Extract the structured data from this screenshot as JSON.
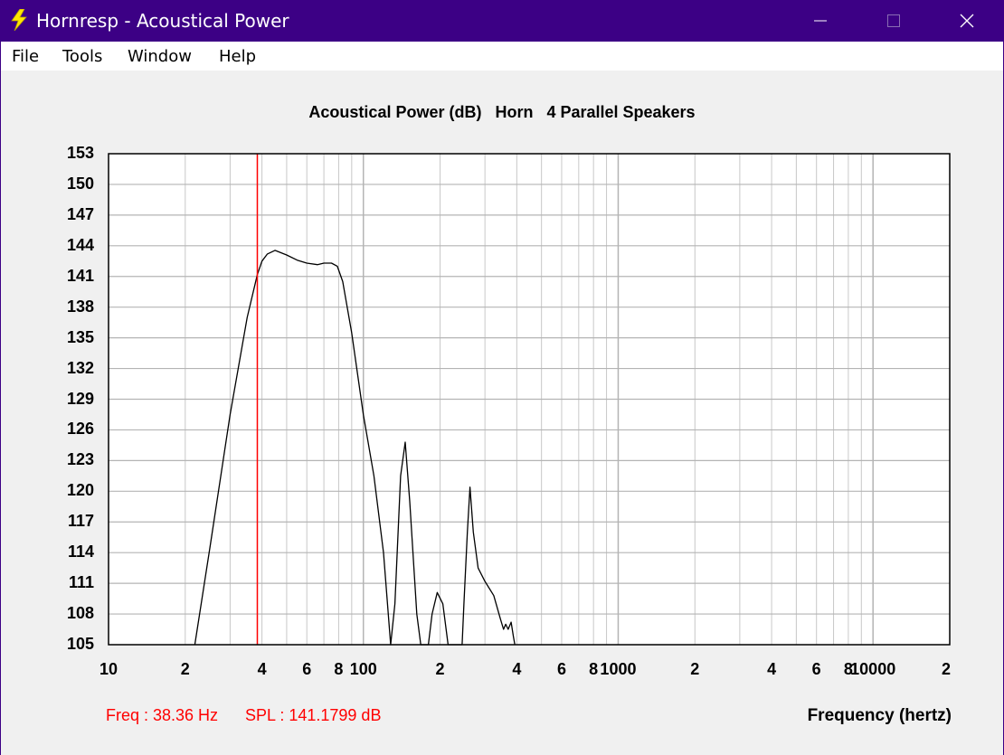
{
  "window": {
    "title": "Hornresp - Acoustical Power",
    "minimize_icon": "minimize-icon",
    "maximize_icon": "maximize-icon",
    "close_icon": "close-icon",
    "app_icon": "lightning-bolt-icon"
  },
  "menu": {
    "items": [
      {
        "label": "File"
      },
      {
        "label": "Tools"
      },
      {
        "label": "Window"
      },
      {
        "label": "Help"
      }
    ]
  },
  "readout": {
    "freq": "Freq : 38.36 Hz",
    "spl": "SPL : 141.1799 dB"
  },
  "colors": {
    "titlebar": "#3c0085",
    "curve": "#000000",
    "cursor": "#ff0000",
    "grid": "#c8c8c8",
    "plot_bg": "#ffffff"
  },
  "chart_data": {
    "type": "line",
    "title": "Acoustical Power (dB)   Horn   4 Parallel Speakers",
    "xlabel": "Frequency (hertz)",
    "ylabel": "",
    "x_scale": "log",
    "xlim": [
      10,
      20000
    ],
    "ylim": [
      105,
      153
    ],
    "grid": true,
    "y_ticks": [
      "153",
      "150",
      "147",
      "144",
      "141",
      "138",
      "135",
      "132",
      "129",
      "126",
      "123",
      "120",
      "117",
      "114",
      "111",
      "108",
      "105"
    ],
    "x_ticks": [
      {
        "value": 10,
        "label": "10"
      },
      {
        "value": 20,
        "label": "2"
      },
      {
        "value": 40,
        "label": "4"
      },
      {
        "value": 60,
        "label": "6"
      },
      {
        "value": 80,
        "label": "8"
      },
      {
        "value": 100,
        "label": "100"
      },
      {
        "value": 200,
        "label": "2"
      },
      {
        "value": 400,
        "label": "4"
      },
      {
        "value": 600,
        "label": "6"
      },
      {
        "value": 800,
        "label": "8"
      },
      {
        "value": 1000,
        "label": "1000"
      },
      {
        "value": 2000,
        "label": "2"
      },
      {
        "value": 4000,
        "label": "4"
      },
      {
        "value": 6000,
        "label": "6"
      },
      {
        "value": 8000,
        "label": "8"
      },
      {
        "value": 10000,
        "label": "10000"
      },
      {
        "value": 20000,
        "label": "2"
      }
    ],
    "cursor": {
      "freq": 38.36,
      "spl": 141.1799
    },
    "series": [
      {
        "points": [
          [
            21.8,
            105
          ],
          [
            25,
            114.5
          ],
          [
            30,
            127.5
          ],
          [
            35,
            137
          ],
          [
            38.36,
            141.18
          ],
          [
            40,
            142.5
          ],
          [
            42,
            143.2
          ],
          [
            45,
            143.55
          ],
          [
            50,
            143.1
          ],
          [
            55,
            142.6
          ],
          [
            60,
            142.3
          ],
          [
            66,
            142.15
          ],
          [
            70,
            142.3
          ],
          [
            75,
            142.3
          ],
          [
            79,
            142.0
          ],
          [
            83,
            140.5
          ],
          [
            90,
            135.5
          ],
          [
            100,
            127.5
          ],
          [
            110,
            121.5
          ],
          [
            120,
            114
          ],
          [
            128,
            105
          ],
          [
            133,
            109
          ],
          [
            140,
            121.5
          ],
          [
            146,
            124.8
          ],
          [
            152,
            119
          ],
          [
            162,
            108
          ],
          [
            168,
            105
          ],
          [
            180,
            105
          ],
          [
            186,
            108
          ],
          [
            195,
            110.1
          ],
          [
            205,
            109
          ],
          [
            215,
            105
          ],
          [
            222,
            105
          ],
          [
            244,
            105
          ],
          [
            248,
            109
          ],
          [
            256,
            116
          ],
          [
            262,
            120.4
          ],
          [
            270,
            116
          ],
          [
            282,
            112.5
          ],
          [
            300,
            111.2
          ],
          [
            325,
            109.8
          ],
          [
            345,
            107.5
          ],
          [
            355,
            106.5
          ],
          [
            362,
            107
          ],
          [
            370,
            106.5
          ],
          [
            380,
            107.2
          ],
          [
            388,
            105.8
          ],
          [
            393,
            105
          ]
        ]
      }
    ]
  }
}
